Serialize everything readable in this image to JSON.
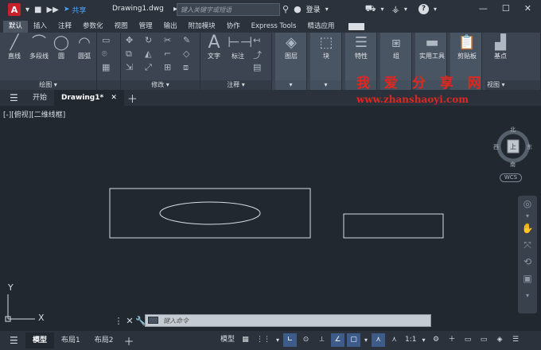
{
  "titlebar": {
    "app_letter": "A",
    "share_label": "共享",
    "document_title": "Drawing1.dwg",
    "search_placeholder": "键入关键字或短语",
    "login_label": "登录",
    "help_label": "?"
  },
  "ribbon_tabs": [
    "默认",
    "插入",
    "注释",
    "参数化",
    "视图",
    "管理",
    "输出",
    "附加模块",
    "协作",
    "Express Tools",
    "精选应用"
  ],
  "ribbon": {
    "draw": {
      "label": "绘图",
      "tools": [
        "直线",
        "多段线",
        "圆",
        "圆弧"
      ]
    },
    "modify": {
      "label": "修改"
    },
    "annotation": {
      "label": "注释",
      "tools": [
        "文字",
        "标注"
      ]
    },
    "layers": {
      "tool": "图层"
    },
    "block": {
      "tool": "块"
    },
    "properties": {
      "tool": "特性"
    },
    "groups": {
      "tool": "组"
    },
    "utilities": {
      "tool": "实用工具"
    },
    "clipboard": {
      "tool": "剪贴板"
    },
    "view": {
      "label": "视图",
      "tool": "基点"
    }
  },
  "file_tabs": {
    "start": "开始",
    "drawing": "Drawing1*"
  },
  "watermark": {
    "text": "我 爱 分 享 网",
    "url": "www.zhanshaoyi.com"
  },
  "viewport": {
    "label": "[-][俯视][二维线框]"
  },
  "navwheel": {
    "north": "北",
    "south": "南",
    "east": "东",
    "west": "西",
    "top": "上",
    "wcs": "WCS"
  },
  "ucs": {
    "x": "X",
    "y": "Y"
  },
  "command": {
    "placeholder": "键入命令"
  },
  "statusbar": {
    "tabs": [
      "模型",
      "布局1",
      "布局2"
    ],
    "model_label": "模型",
    "scale": "1:1"
  },
  "colors": {
    "accent": "#4aa3ff",
    "watermark": "#e0271f",
    "app_red": "#c8202b"
  }
}
